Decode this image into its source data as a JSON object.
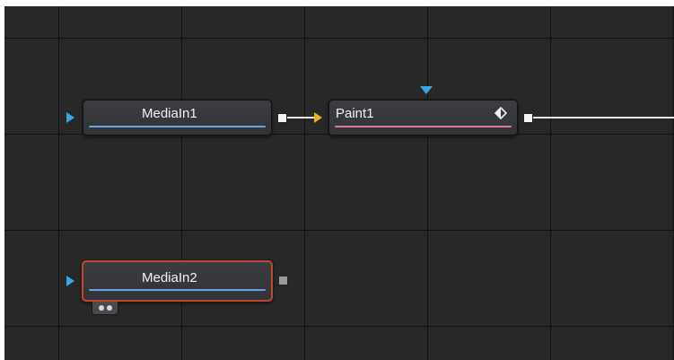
{
  "canvas": {
    "background": "#282828",
    "grid_color": "#1a1a1a"
  },
  "nodes": [
    {
      "id": "mediain1",
      "label": "MediaIn1",
      "type": "media-in",
      "accent_color": "#6aa3e0",
      "input_port_color": "#3aa6e6",
      "selected": false
    },
    {
      "id": "paint1",
      "label": "Paint1",
      "type": "paint",
      "accent_color": "#d9789b",
      "input_port_color": "#e6b41e",
      "effect_mask_port_color": "#3aa6e6",
      "icon": "diamond-keyframe-icon",
      "selected": false
    },
    {
      "id": "mediain2",
      "label": "MediaIn2",
      "type": "media-in",
      "accent_color": "#6aa3e0",
      "input_port_color": "#3aa6e6",
      "selected": true,
      "selection_color": "#c5462f",
      "badge_icon": "cache-dots-icon"
    }
  ],
  "connections": [
    {
      "from": "mediain1",
      "to": "paint1"
    },
    {
      "from": "paint1",
      "to": "offscreen-right"
    }
  ]
}
